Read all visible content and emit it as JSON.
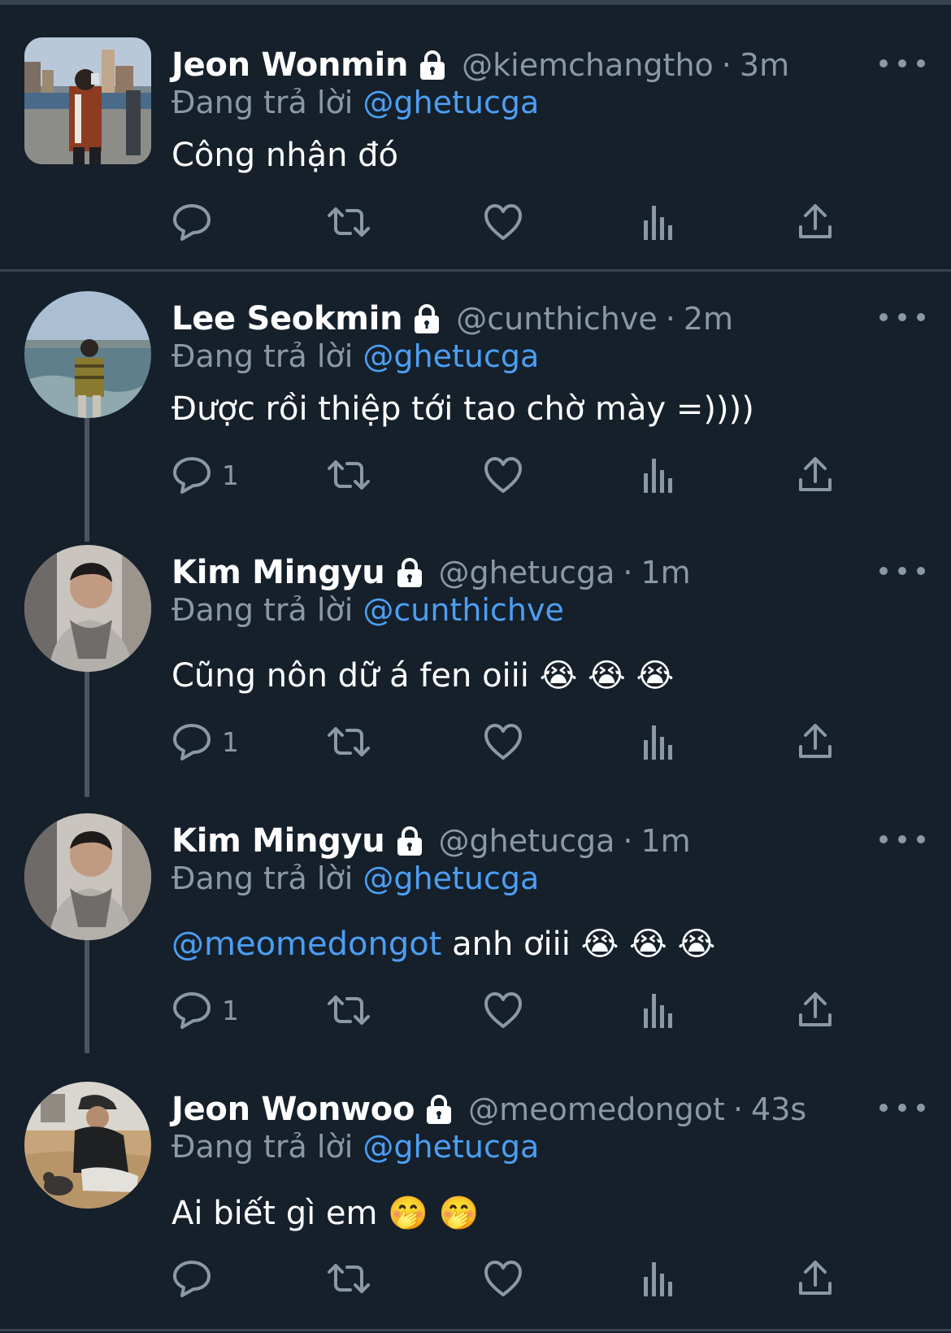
{
  "colors": {
    "background": "#15202b",
    "divider": "#38444d",
    "muted": "#8b98a5",
    "link": "#4d9ef2",
    "text": "#ffffff"
  },
  "labels": {
    "replying_to": "Đang trả lời",
    "separator": "·"
  },
  "icons": [
    "lock-icon",
    "more-icon",
    "reply-icon",
    "retweet-icon",
    "like-icon",
    "analytics-icon",
    "share-icon"
  ],
  "tweets": [
    {
      "name": "Jeon Wonmin",
      "handle": "@kiemchangtho",
      "time": "3m",
      "reply_to": "@ghetucga",
      "text": "Công nhận đó",
      "replies": ""
    },
    {
      "name": "Lee Seokmin",
      "handle": "@cunthichve",
      "time": "2m",
      "reply_to": "@ghetucga",
      "text": "Được rồi thiệp tới tao chờ mày =))))",
      "replies": "1"
    },
    {
      "name": "Kim Mingyu",
      "handle": "@ghetucga",
      "time": "1m",
      "reply_to": "@cunthichve",
      "text": "Cũng nôn dữ á fen oiii 😭 😭 😭",
      "replies": "1"
    },
    {
      "name": "Kim Mingyu",
      "handle": "@ghetucga",
      "time": "1m",
      "reply_to": "@ghetucga",
      "text_mention": "@meomedongot",
      "text": " anh ơiii 😭 😭 😭",
      "replies": "1"
    },
    {
      "name": "Jeon Wonwoo",
      "handle": "@meomedongot",
      "time": "43s",
      "reply_to": "@ghetucga",
      "text": "Ai biết gì em 🤭 🤭",
      "replies": ""
    }
  ]
}
